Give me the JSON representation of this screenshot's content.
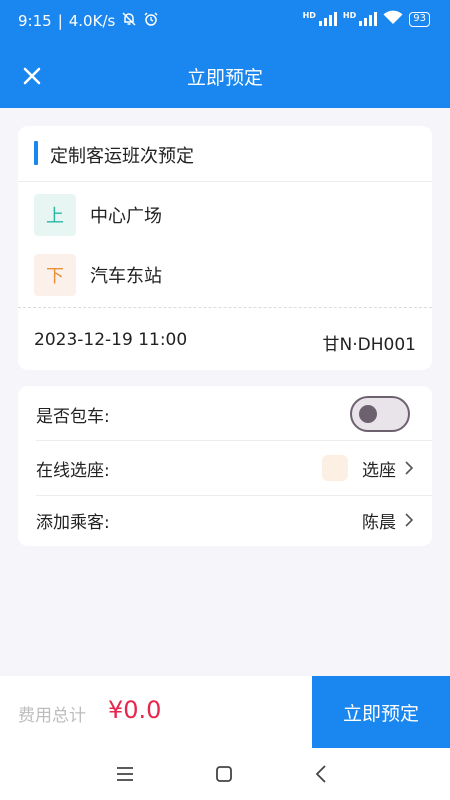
{
  "status": {
    "time": "9:15",
    "net_speed": "4.0K/s",
    "signal_1_label": "HD",
    "signal_2_label": "HD",
    "battery": "93",
    "icons": [
      "bell-muted-icon",
      "alarm-icon",
      "signal-icon",
      "wifi-icon",
      "battery-icon"
    ]
  },
  "header": {
    "title": "立即预定",
    "close_icon": "close-icon"
  },
  "trip": {
    "section_title": "定制客运班次预定",
    "board_badge": "上",
    "board_stop": "中心广场",
    "alight_badge": "下",
    "alight_stop": "汽车东站",
    "datetime": "2023-12-19 11:00",
    "plate": "甘N·DH001"
  },
  "options": {
    "charter_label": "是否包车:",
    "charter_enabled": false,
    "seat_label": "在线选座:",
    "seat_value": "选座",
    "passenger_label": "添加乘客:",
    "passenger_value": "陈晨"
  },
  "footer": {
    "total_label": "费用总计",
    "total_amount": "¥0.0",
    "book_button": "立即预定"
  },
  "colors": {
    "brand": "#1a86f0",
    "price": "#e8254b",
    "board": "#28b6a4",
    "alight": "#e6913a"
  },
  "nav": [
    "menu-icon",
    "home-icon",
    "back-icon"
  ]
}
